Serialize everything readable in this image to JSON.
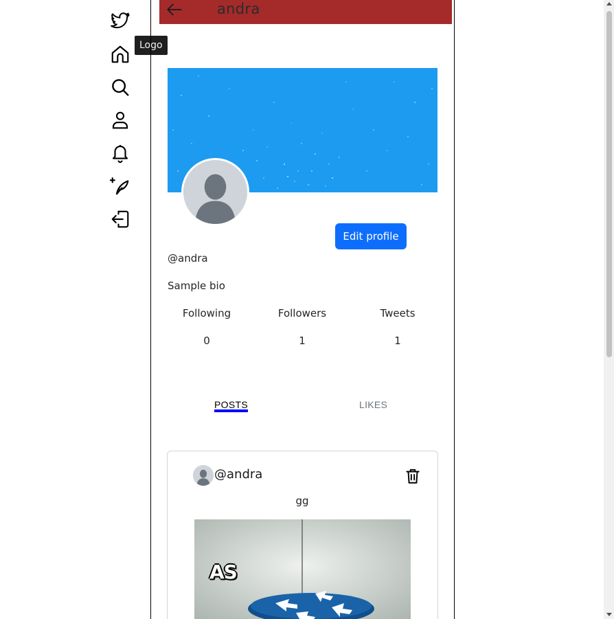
{
  "sidebar": {
    "items": [
      {
        "name": "twitter-logo-icon"
      },
      {
        "name": "home-icon"
      },
      {
        "name": "search-icon"
      },
      {
        "name": "profile-icon"
      },
      {
        "name": "bell-icon"
      },
      {
        "name": "new-tweet-icon"
      },
      {
        "name": "logout-icon"
      }
    ],
    "tooltip": "Logo"
  },
  "header": {
    "title": "andra",
    "back_icon": "arrow-left-icon",
    "bg_color": "#a52a2a"
  },
  "profile": {
    "banner_color": "#1d9bf0",
    "edit_label": "Edit profile",
    "handle": "@andra",
    "bio": "Sample bio",
    "stats": [
      {
        "label": "Following",
        "value": "0"
      },
      {
        "label": "Followers",
        "value": "1"
      },
      {
        "label": "Tweets",
        "value": "1"
      }
    ]
  },
  "tabs": [
    {
      "label": "POSTS",
      "active": true
    },
    {
      "label": "LIKES",
      "active": false
    }
  ],
  "posts": [
    {
      "handle": "@andra",
      "text": "gg",
      "image_caption": "AS",
      "delete_icon": "trash-icon"
    }
  ],
  "colors": {
    "accent": "#0d6efd",
    "tab_underline": "#0000ff"
  }
}
